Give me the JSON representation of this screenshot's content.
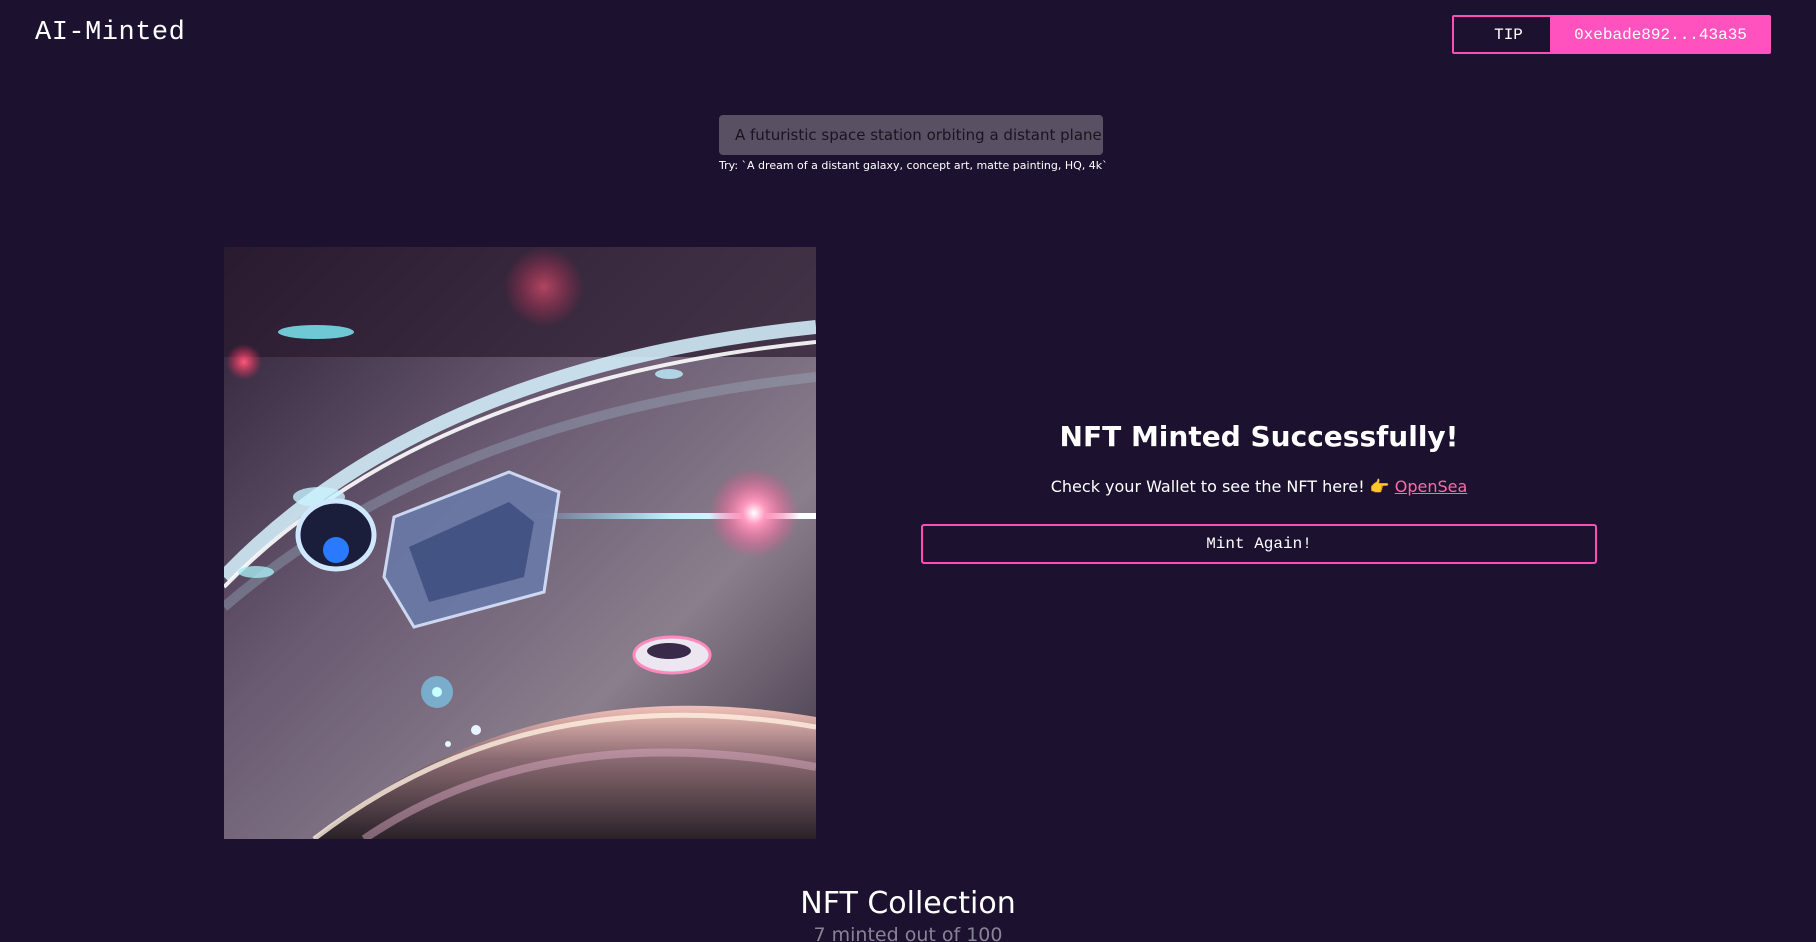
{
  "header": {
    "logo": "AI-Minted",
    "tip_label": "TIP",
    "wallet_label": "0xebade892...43a35"
  },
  "prompt": {
    "value": "A futuristic space station orbiting a distant plane",
    "hint": "Try: `A dream of a distant galaxy, concept art, matte painting, HQ, 4k`"
  },
  "result": {
    "title": "NFT Minted Successfully!",
    "message": "Check your Wallet to see the NFT here! 👉 ",
    "link_label": "OpenSea",
    "mint_again_label": "Mint Again!"
  },
  "collection": {
    "title": "NFT Collection",
    "subtitle": "7 minted out of 100"
  },
  "colors": {
    "background": "#1c1230",
    "accent": "#ff52bf",
    "link": "#ff6aa8"
  }
}
